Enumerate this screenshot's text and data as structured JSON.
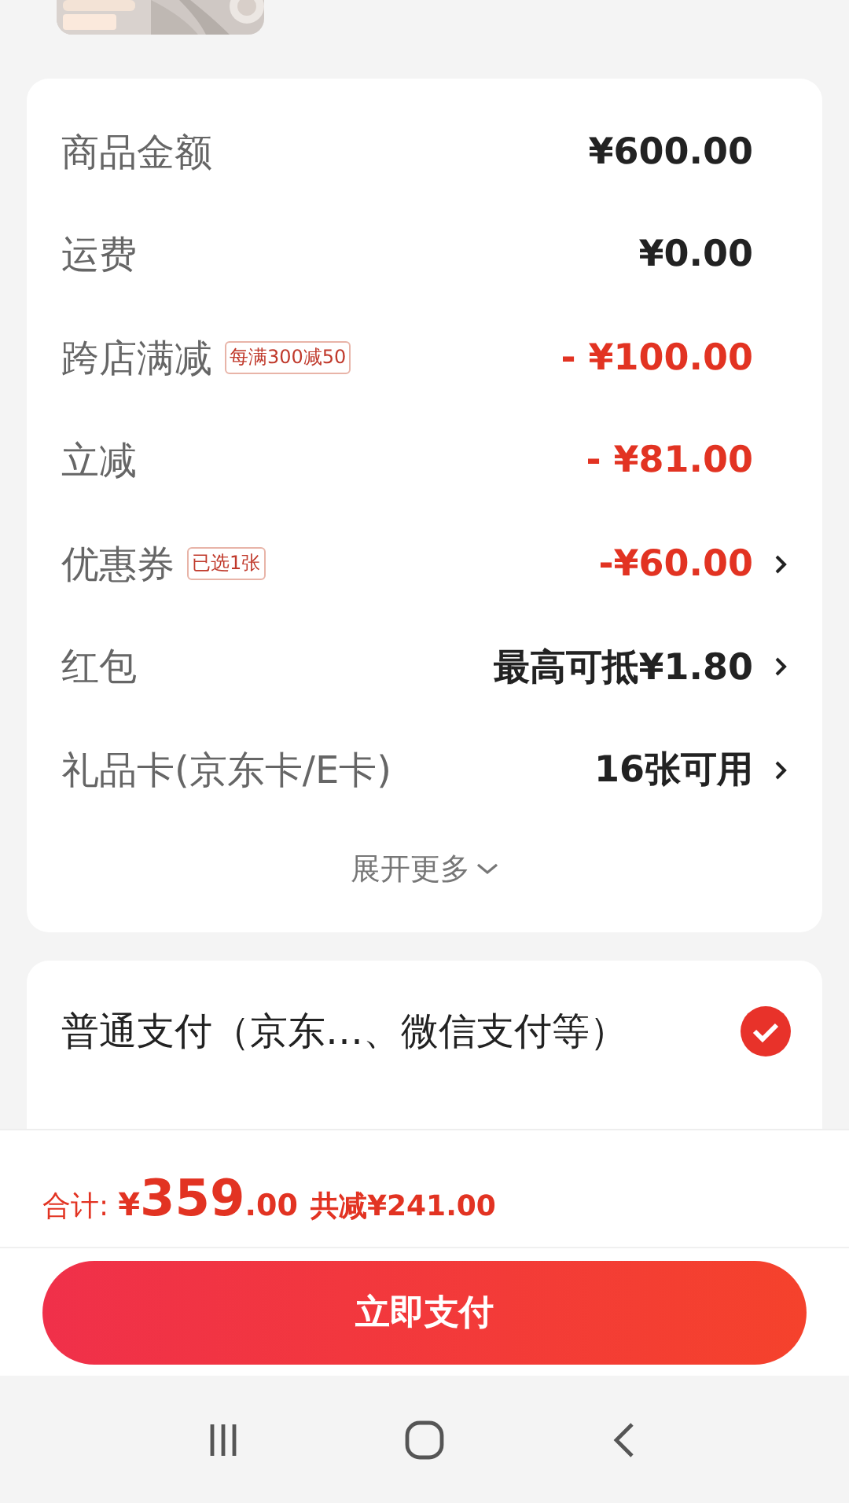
{
  "price_rows": [
    {
      "label": "商品金额",
      "value": "¥600.00",
      "kind": "amount",
      "arrow": false
    },
    {
      "label": "运费",
      "value": "¥0.00",
      "kind": "amount",
      "arrow": false
    },
    {
      "label": "跨店满减",
      "tag": "每满300减50",
      "value": "- ¥100.00",
      "kind": "discount",
      "arrow": false
    },
    {
      "label": "立减",
      "value": "- ¥81.00",
      "kind": "discount",
      "arrow": false
    },
    {
      "label": "优惠券",
      "tag": "已选1张",
      "value": "-¥60.00",
      "kind": "discount",
      "arrow": true
    },
    {
      "label": "红包",
      "value": "最高可抵¥1.80",
      "kind": "amount",
      "arrow": true
    },
    {
      "label": "礼品卡(京东卡/E卡)",
      "value": "16张可用",
      "kind": "amount",
      "arrow": true
    }
  ],
  "expand_more": "展开更多",
  "payment_options": [
    {
      "label": "普通支付（京东…、微信支付等）",
      "selected": true
    }
  ],
  "footer": {
    "total_label": "合计:",
    "currency": "¥",
    "total_integer": "359",
    "total_decimal": ".00",
    "saved": "共减¥241.00",
    "pay_button": "立即支付"
  }
}
